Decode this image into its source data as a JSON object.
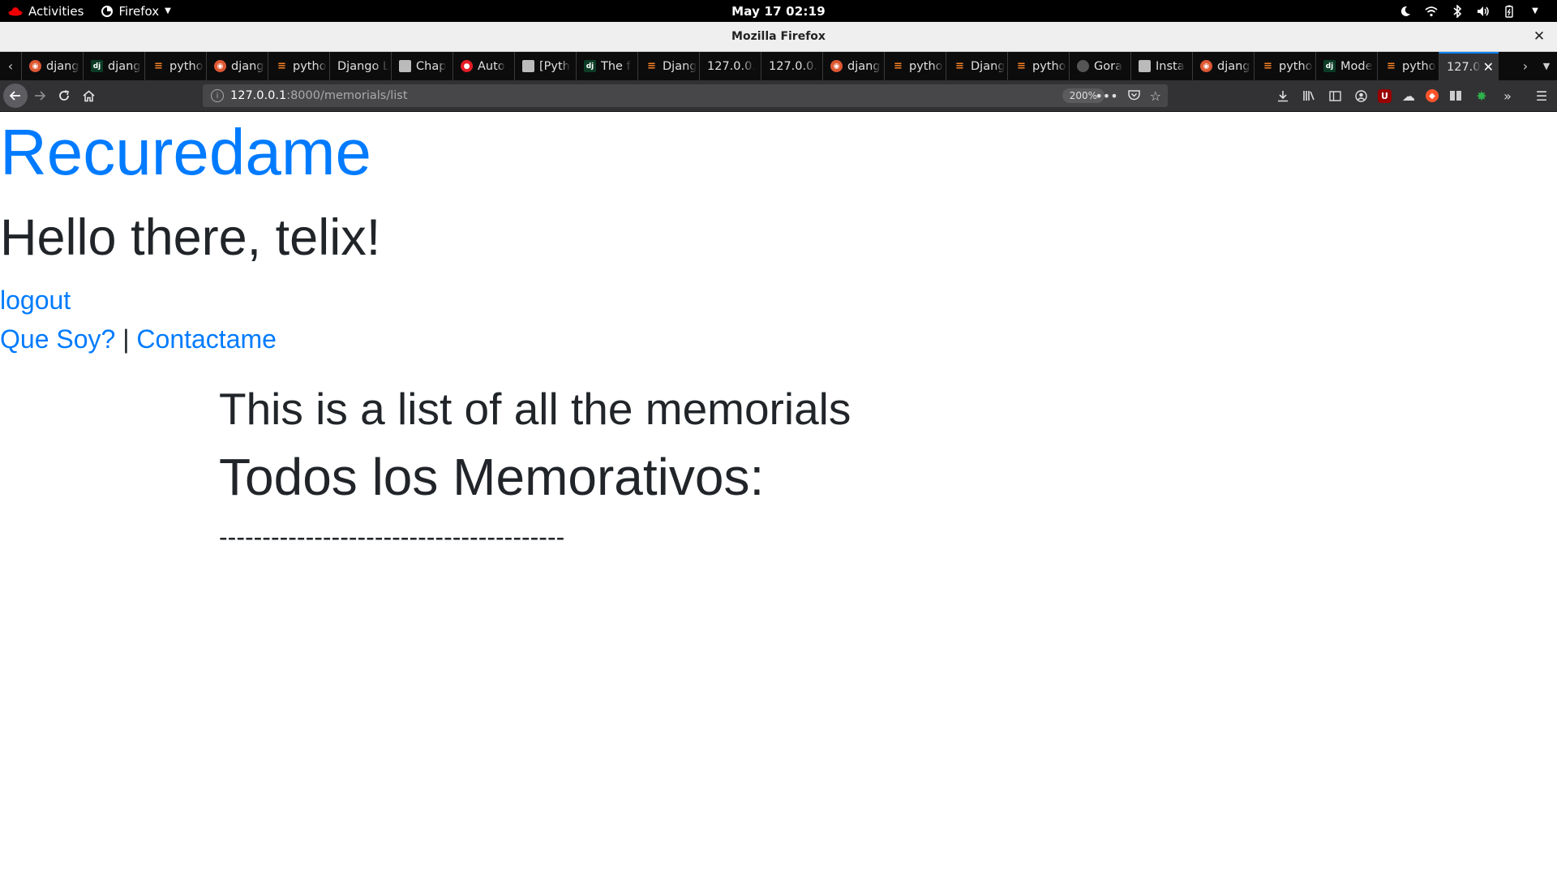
{
  "system_bar": {
    "activities": "Activities",
    "app_menu": "Firefox",
    "clock": "May 17  02:19"
  },
  "window": {
    "title": "Mozilla Firefox"
  },
  "tabs": [
    {
      "label": "djang",
      "icon": "ddg"
    },
    {
      "label": "djang",
      "icon": "dj"
    },
    {
      "label": "pytho",
      "icon": "so"
    },
    {
      "label": "djang",
      "icon": "ddg"
    },
    {
      "label": "pytho",
      "icon": "so"
    },
    {
      "label": "Django L",
      "icon": "none"
    },
    {
      "label": "Chap",
      "icon": "doc"
    },
    {
      "label": "Auto",
      "icon": "red"
    },
    {
      "label": "[Pyth",
      "icon": "doc"
    },
    {
      "label": "The f",
      "icon": "dj"
    },
    {
      "label": "Djang",
      "icon": "so"
    },
    {
      "label": "127.0.0.",
      "icon": "none"
    },
    {
      "label": "127.0.0.",
      "icon": "none"
    },
    {
      "label": "djang",
      "icon": "ddg"
    },
    {
      "label": "pytho",
      "icon": "so"
    },
    {
      "label": "Djang",
      "icon": "so"
    },
    {
      "label": "pytho",
      "icon": "so"
    },
    {
      "label": "Gora",
      "icon": "gh"
    },
    {
      "label": "Insta",
      "icon": "doc"
    },
    {
      "label": "djang",
      "icon": "ddg"
    },
    {
      "label": "pytho",
      "icon": "so"
    },
    {
      "label": "Mode",
      "icon": "dj"
    },
    {
      "label": "pytho",
      "icon": "so"
    }
  ],
  "active_tab": {
    "label": "127.0"
  },
  "urlbar": {
    "host": "127.0.0.1",
    "path": ":8000/memorials/list",
    "zoom": "200%"
  },
  "page": {
    "brand": "Recuredame",
    "greeting": "Hello there, telix!",
    "logout": "logout",
    "link_about": "Que Soy?",
    "separator": "|",
    "link_contact": "Contactame",
    "intro": "This is a list of all the memorials",
    "heading": "Todos los Memorativos:",
    "divider": "----------------------------------------"
  },
  "colors": {
    "link": "#007bff",
    "text": "#212529",
    "tab_accent": "#0a84ff"
  }
}
